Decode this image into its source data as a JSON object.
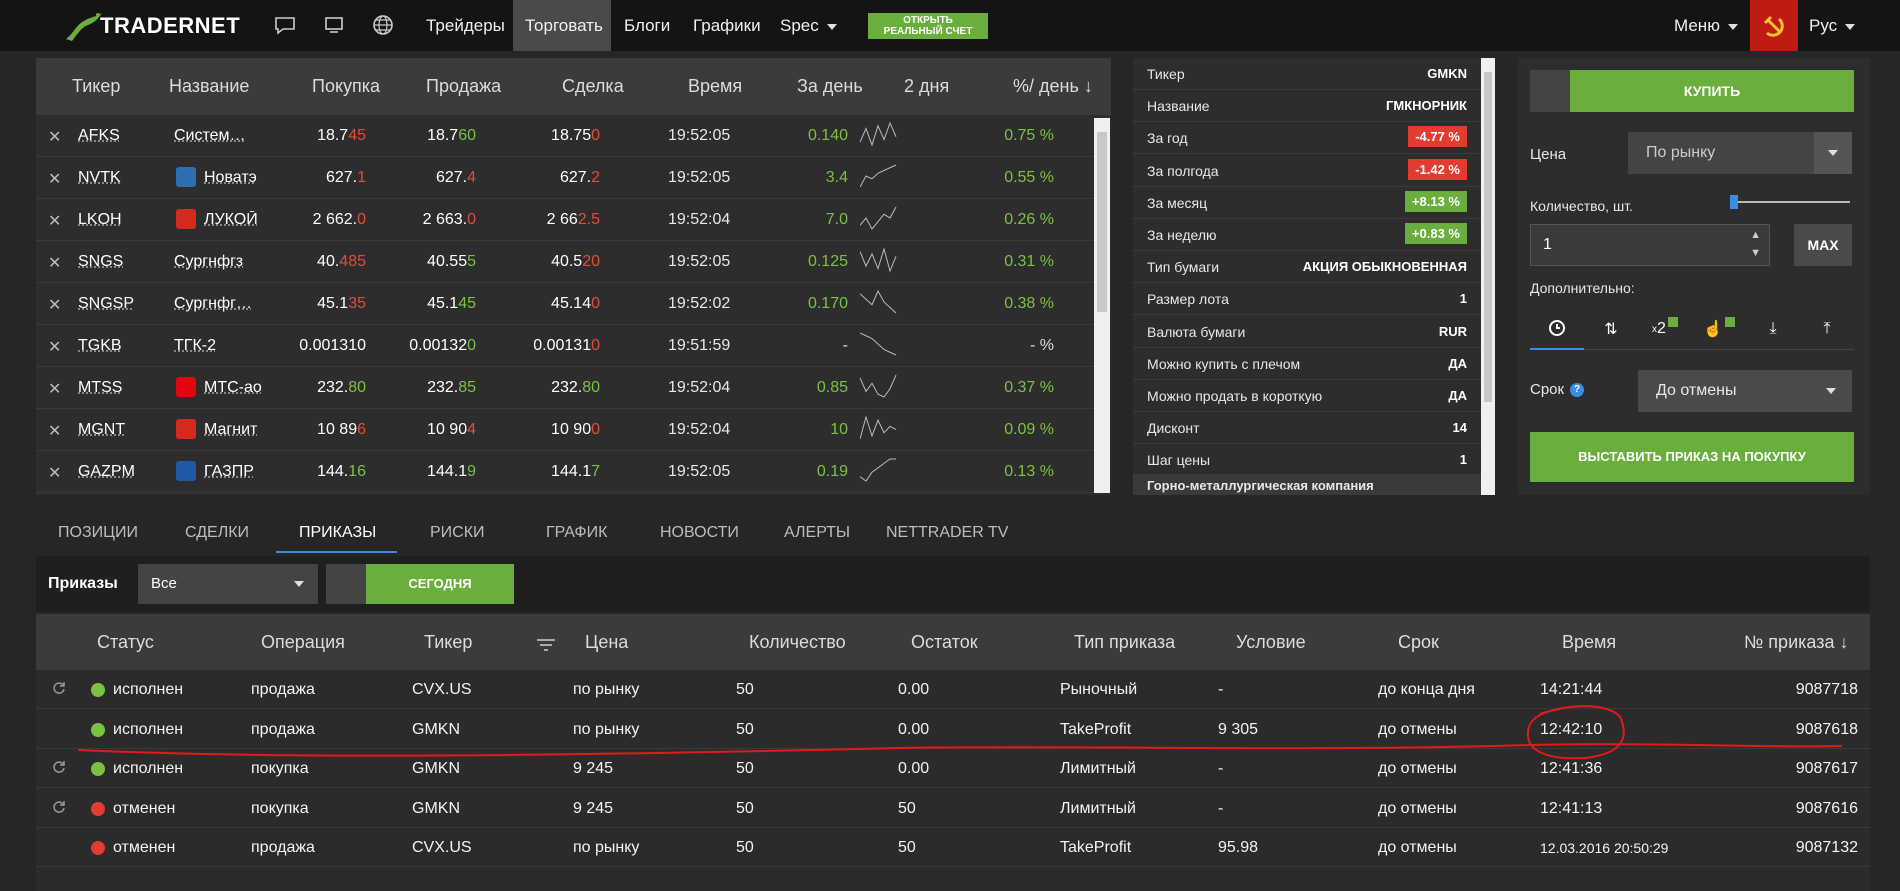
{
  "nav": {
    "logo": "TRADERNET",
    "links": [
      "Трейдеры",
      "Торговать",
      "Блоги",
      "Графики",
      "Spec"
    ],
    "open_account": [
      "ОТКРЫТЬ",
      "РЕАЛЬНЫЙ СЧЕТ"
    ],
    "menu": "Меню",
    "lang": "Рус"
  },
  "watchlist": {
    "headers": [
      "Тикер",
      "Название",
      "Покупка",
      "Продажа",
      "Сделка",
      "Время",
      "За день",
      "2 дня",
      "%/ день ↓"
    ],
    "rows": [
      {
        "ticker": "AFKS",
        "name": "Систем…",
        "icon": "",
        "bid": [
          "18.7",
          "45"
        ],
        "ask": [
          "18.7",
          "60"
        ],
        "last": [
          "18.75",
          "0"
        ],
        "time": "19:52:05",
        "day": "0.140",
        "pct": "0.75 %",
        "spark": [
          3,
          8,
          2,
          9,
          4,
          10,
          5
        ]
      },
      {
        "ticker": "NVTK",
        "name": "Новатэ",
        "icon": "nvtk-icon",
        "bid": [
          "627.",
          "1"
        ],
        "ask": [
          "627.",
          "4"
        ],
        "last": [
          "627.",
          "2"
        ],
        "time": "19:52:05",
        "day": "3.4",
        "pct": "0.55 %",
        "spark": [
          2,
          6,
          5,
          7,
          8,
          9,
          10
        ]
      },
      {
        "ticker": "LKOH",
        "name": "ЛУКОЙ",
        "icon": "lkoh-icon",
        "bid": [
          "2 662.",
          "0"
        ],
        "ask": [
          "2 663.",
          "0"
        ],
        "last": [
          "2 66",
          "2.5"
        ],
        "time": "19:52:04",
        "day": "7.0",
        "pct": "0.26 %",
        "spark": [
          3,
          5,
          2,
          4,
          6,
          5,
          8
        ]
      },
      {
        "ticker": "SNGS",
        "name": "Сургнфгз",
        "icon": "",
        "bid": [
          "40.",
          "485"
        ],
        "ask": [
          "40.55",
          "5"
        ],
        "last": [
          "40.5",
          "20"
        ],
        "time": "19:52:05",
        "day": "0.125",
        "pct": "0.31 %",
        "spark": [
          9,
          3,
          8,
          2,
          10,
          1,
          7
        ]
      },
      {
        "ticker": "SNGSP",
        "name": "Сургнфг…",
        "icon": "",
        "bid": [
          "45.1",
          "35"
        ],
        "ask": [
          "45.1",
          "45"
        ],
        "last": [
          "45.14",
          "0"
        ],
        "time": "19:52:02",
        "day": "0.170",
        "pct": "0.38 %",
        "spark": [
          8,
          6,
          4,
          9,
          5,
          3,
          1
        ]
      },
      {
        "ticker": "TGKB",
        "name": "ТГК-2",
        "icon": "",
        "bid": [
          "0.001310",
          ""
        ],
        "ask": [
          "0.00132",
          "0"
        ],
        "last": [
          "0.00131",
          "0"
        ],
        "time": "19:51:59",
        "day": "-",
        "pct": "- %",
        "spark": [
          9,
          8,
          7,
          5,
          3,
          2,
          1
        ]
      },
      {
        "ticker": "MTSS",
        "name": "МТС-ао",
        "icon": "mtss-icon",
        "bid": [
          "232.",
          "80"
        ],
        "ask": [
          "232.",
          "85"
        ],
        "last": [
          "232.",
          "80"
        ],
        "time": "19:52:04",
        "day": "0.85",
        "pct": "0.37 %",
        "spark": [
          8,
          3,
          6,
          2,
          1,
          4,
          9
        ]
      },
      {
        "ticker": "MGNT",
        "name": "Магнит",
        "icon": "mgnt-icon",
        "bid": [
          "10 89",
          "6"
        ],
        "ask": [
          "10 90",
          "4"
        ],
        "last": [
          "10 90",
          "0"
        ],
        "time": "19:52:04",
        "day": "10",
        "pct": "0.09 %",
        "spark": [
          2,
          9,
          3,
          8,
          4,
          6,
          5
        ]
      },
      {
        "ticker": "GAZPM",
        "name": "ГАЗПР",
        "icon": "gazp-icon",
        "bid": [
          "144.",
          "16"
        ],
        "ask": [
          "144.1",
          "9"
        ],
        "last": [
          "144.1",
          "7"
        ],
        "time": "19:52:05",
        "day": "0.19",
        "pct": "0.13 %",
        "spark": [
          5,
          4,
          6,
          7,
          8,
          9,
          9
        ]
      }
    ]
  },
  "info": {
    "rows": [
      {
        "k": "Тикер",
        "v": "GMKN",
        "s": ""
      },
      {
        "k": "Название",
        "v": "ГМКНОРНИК",
        "s": ""
      },
      {
        "k": "За год",
        "v": "-4.77 %",
        "s": "bad"
      },
      {
        "k": "За полгода",
        "v": "-1.42 %",
        "s": "bad"
      },
      {
        "k": "За месяц",
        "v": "+8.13 %",
        "s": "good"
      },
      {
        "k": "За неделю",
        "v": "+0.83 %",
        "s": "good"
      },
      {
        "k": "Тип бумаги",
        "v": "АКЦИЯ ОБЫКНОВЕННАЯ",
        "s": ""
      },
      {
        "k": "Размер лота",
        "v": "1",
        "s": ""
      },
      {
        "k": "Валюта бумаги",
        "v": "RUR",
        "s": ""
      },
      {
        "k": "Можно купить с плечом",
        "v": "ДА",
        "s": ""
      },
      {
        "k": "Можно продать в короткую",
        "v": "ДА",
        "s": ""
      },
      {
        "k": "Дисконт",
        "v": "14",
        "s": ""
      },
      {
        "k": "Шаг цены",
        "v": "1",
        "s": ""
      }
    ],
    "footer": "Горно-металлургическая компания"
  },
  "order": {
    "buy": "КУПИТЬ",
    "price_label": "Цена",
    "price_value": "По рынку",
    "qty_label": "Количество, шт.",
    "qty_value": "1",
    "max": "MAX",
    "extra_label": "Дополнительно:",
    "term_label": "Срок",
    "term_value": "До отмены",
    "submit": "ВЫСТАВИТЬ ПРИКАЗ НА ПОКУПКУ"
  },
  "tabs": [
    "ПОЗИЦИИ",
    "СДЕЛКИ",
    "ПРИКАЗЫ",
    "РИСКИ",
    "ГРАФИК",
    "НОВОСТИ",
    "АЛЕРТЫ",
    "NETTRADER TV"
  ],
  "filter": {
    "label": "Приказы",
    "select": "Все",
    "today": "СЕГОДНЯ"
  },
  "orders": {
    "headers": [
      "Статус",
      "Операция",
      "Тикер",
      "Цена",
      "Количество",
      "Остаток",
      "Тип приказа",
      "Условие",
      "Срок",
      "Время",
      "№ приказа ↓"
    ],
    "rows": [
      {
        "refresh": true,
        "status": "исполнен",
        "color": "#7cc242",
        "op": "продажа",
        "ticker": "CVX.US",
        "price": "по рынку",
        "qty": "50",
        "rest": "0.00",
        "type": "Рыночный",
        "cond": "-",
        "term": "до конца дня",
        "time": "14:21:44",
        "id": "9087718"
      },
      {
        "refresh": false,
        "status": "исполнен",
        "color": "#7cc242",
        "op": "продажа",
        "ticker": "GMKN",
        "price": "по рынку",
        "qty": "50",
        "rest": "0.00",
        "type": "TakeProfit",
        "cond": "9 305",
        "term": "до отмены",
        "time": "12:42:10",
        "id": "9087618"
      },
      {
        "refresh": true,
        "status": "исполнен",
        "color": "#7cc242",
        "op": "покупка",
        "ticker": "GMKN",
        "price": "9 245",
        "qty": "50",
        "rest": "0.00",
        "type": "Лимитный",
        "cond": "-",
        "term": "до отмены",
        "time": "12:41:36",
        "id": "9087617"
      },
      {
        "refresh": true,
        "status": "отменен",
        "color": "#e23b30",
        "op": "покупка",
        "ticker": "GMKN",
        "price": "9 245",
        "qty": "50",
        "rest": "50",
        "type": "Лимитный",
        "cond": "-",
        "term": "до отмены",
        "time": "12:41:13",
        "id": "9087616"
      },
      {
        "refresh": false,
        "status": "отменен",
        "color": "#e23b30",
        "op": "продажа",
        "ticker": "CVX.US",
        "price": "по рынку",
        "qty": "50",
        "rest": "50",
        "type": "TakeProfit",
        "cond": "95.98",
        "term": "до отмены",
        "time": "12.03.2016 20:50:29",
        "id": "9087132"
      }
    ]
  }
}
